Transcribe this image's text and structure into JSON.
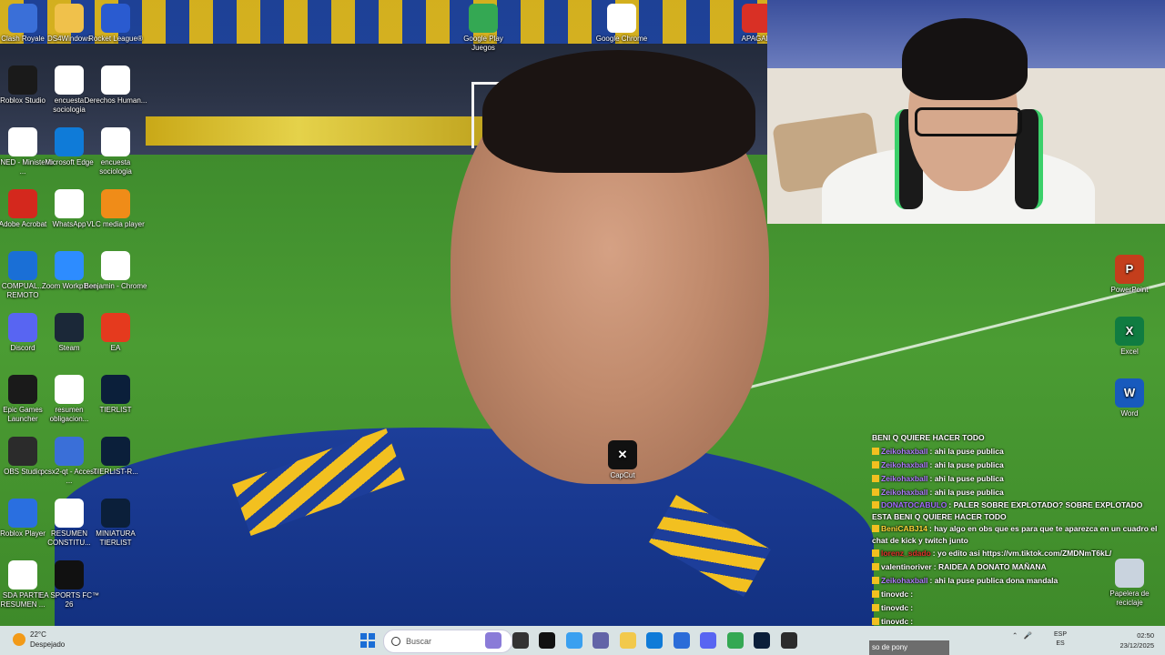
{
  "desktop": {
    "icons_left": [
      {
        "label": "Clash Royale",
        "icon": "clash-royale-icon",
        "color": "#3a6fd8"
      },
      {
        "label": "DS4Windows",
        "icon": "folder-icon",
        "color": "#f0c14b"
      },
      {
        "label": "Rocket League®",
        "icon": "rocket-league-icon",
        "color": "#2a5bd0"
      },
      {
        "label": "Roblox Studio",
        "icon": "roblox-studio-icon",
        "color": "#1a1a1a"
      },
      {
        "label": "encuesta sociologia",
        "icon": "chrome-icon",
        "color": "#ffffff"
      },
      {
        "label": "Derechos Human...",
        "icon": "word-icon",
        "color": "#ffffff"
      },
      {
        "label": "MINED - Ministerio ...",
        "icon": "chrome-icon",
        "color": "#ffffff"
      },
      {
        "label": "Microsoft Edge",
        "icon": "edge-icon",
        "color": "#0f7bd8"
      },
      {
        "label": "encuesta sociologia",
        "icon": "chrome-icon",
        "color": "#ffffff"
      },
      {
        "label": "Adobe Acrobat",
        "icon": "acrobat-icon",
        "color": "#d4281d"
      },
      {
        "label": "WhatsApp",
        "icon": "document-icon",
        "color": "#ffffff"
      },
      {
        "label": "VLC media player",
        "icon": "vlc-icon",
        "color": "#f08c18"
      },
      {
        "label": "COMPUAL... REMOTO",
        "icon": "teamviewer-icon",
        "color": "#1a6fd6"
      },
      {
        "label": "Zoom Workplace",
        "icon": "zoom-icon",
        "color": "#2d8cff"
      },
      {
        "label": "Benjamin - Chrome",
        "icon": "chrome-icon",
        "color": "#ffffff"
      },
      {
        "label": "Discord",
        "icon": "discord-icon",
        "color": "#5865f2"
      },
      {
        "label": "Steam",
        "icon": "steam-icon",
        "color": "#1b2838"
      },
      {
        "label": "EA",
        "icon": "ea-icon",
        "color": "#e53a1e"
      },
      {
        "label": "Epic Games Launcher",
        "icon": "epic-games-icon",
        "color": "#1a1a1a"
      },
      {
        "label": "resumen obligacion...",
        "icon": "word-icon",
        "color": "#ffffff"
      },
      {
        "label": "TIERLIST",
        "icon": "psb-icon",
        "color": "#0b1f3a"
      },
      {
        "label": "OBS Studio",
        "icon": "obs-icon",
        "color": "#2b2b2b"
      },
      {
        "label": "pcsx2-qt - Acceso ...",
        "icon": "pcsx2-icon",
        "color": "#3a6fd8"
      },
      {
        "label": "TIERLIST-R...",
        "icon": "psb-icon",
        "color": "#0b1f3a"
      },
      {
        "label": "Roblox Player",
        "icon": "roblox-icon",
        "color": "#2a6fe0"
      },
      {
        "label": "RESUMEN CONSTITU...",
        "icon": "word-icon",
        "color": "#ffffff"
      },
      {
        "label": "MINIATURA TIERLIST",
        "icon": "psb-icon",
        "color": "#0b1f3a"
      },
      {
        "label": "SDA PARTE RESUMEN ...",
        "icon": "word-icon",
        "color": "#ffffff"
      },
      {
        "label": "EA SPORTS FC™ 26",
        "icon": "ea-fc-icon",
        "color": "#111111"
      }
    ],
    "icons_top": [
      {
        "label": "Google Play Juegos",
        "icon": "google-play-icon",
        "color": "#34a853"
      },
      {
        "label": "Google Chrome",
        "icon": "chrome-icon",
        "color": "#ffffff"
      },
      {
        "label": "APAGAR",
        "icon": "power-icon",
        "color": "#d93025"
      }
    ],
    "icon_center": {
      "label": "CapCut",
      "icon": "capcut-icon",
      "color": "#111111"
    },
    "icons_right": [
      {
        "label": "PowerPoint",
        "icon": "powerpoint-icon",
        "color": "#c43e1c",
        "letter": "P"
      },
      {
        "label": "Excel",
        "icon": "excel-icon",
        "color": "#107c41",
        "letter": "X"
      },
      {
        "label": "Word",
        "icon": "word-icon",
        "color": "#185abd",
        "letter": "W"
      },
      {
        "label": "Papelera de reciclaje",
        "icon": "recycle-bin-icon",
        "color": "#c9d3de",
        "letter": ""
      }
    ]
  },
  "chat": {
    "lines": [
      {
        "user": "",
        "user_color": "#ffffff",
        "msg": "BENI Q QUIERE HACER TODO",
        "wrap": false
      },
      {
        "user": "Zeikohaxball",
        "user_color": "#b07cff",
        "msg": ": ahi la puse publica",
        "wrap": false
      },
      {
        "user": "Zeikohaxball",
        "user_color": "#b07cff",
        "msg": ": ahi la puse publica",
        "wrap": false
      },
      {
        "user": "Zeikohaxball",
        "user_color": "#b07cff",
        "msg": ": ahi la puse publica",
        "wrap": false
      },
      {
        "user": "Zeikohaxball",
        "user_color": "#b07cff",
        "msg": ": ahi la puse publica",
        "wrap": false
      },
      {
        "user": "DONATOCABULO",
        "user_color": "#a46cff",
        "msg": ": PALER SOBRE EXPLOTADO? SOBRE EXPLOTADO ESTA BENI Q QUIERE HACER TODO",
        "wrap": true
      },
      {
        "user": "BeniCABJ14",
        "user_color": "#ffd83a",
        "msg": ": hay algo en obs que es para que te aparezca en un cuadro el chat de kick y twitch junto",
        "wrap": true
      },
      {
        "user": "lorenz_sdado",
        "user_color": "#e0302a",
        "msg": ": yo edito asi https://vm.tiktok.com/ZMDNmT6kL/",
        "wrap": false
      },
      {
        "user": "valentinoriver",
        "user_color": "#ffffff",
        "msg": ": RAIDEA A DONATO MAÑANA",
        "wrap": false
      },
      {
        "user": "Zeikohaxball",
        "user_color": "#b07cff",
        "msg": ": ahi la puse publica dona mandala",
        "wrap": false
      },
      {
        "user": "tinovdc",
        "user_color": "#ffffff",
        "msg": ":",
        "wrap": false
      },
      {
        "user": "tinovdc",
        "user_color": "#ffffff",
        "msg": ":",
        "wrap": false
      },
      {
        "user": "tinovdc",
        "user_color": "#ffffff",
        "msg": ":",
        "wrap": false
      }
    ],
    "ticker": "so de pony"
  },
  "taskbar": {
    "weather_temp": "22°C",
    "weather_desc": "Despejado",
    "search_placeholder": "Buscar",
    "apps": [
      {
        "name": "taskbar-app-widgets",
        "color": "#8a7bd8"
      },
      {
        "name": "taskbar-app-task-view",
        "color": "#333333"
      },
      {
        "name": "taskbar-app-capcut",
        "color": "#111111"
      },
      {
        "name": "taskbar-app-copilot",
        "color": "#3aa0f0"
      },
      {
        "name": "taskbar-app-teams",
        "color": "#6264a7"
      },
      {
        "name": "taskbar-app-explorer",
        "color": "#f2c94c"
      },
      {
        "name": "taskbar-app-edge",
        "color": "#0f7bd8"
      },
      {
        "name": "taskbar-app-store",
        "color": "#2b6cd8"
      },
      {
        "name": "taskbar-app-discord",
        "color": "#5865f2"
      },
      {
        "name": "taskbar-app-chrome",
        "color": "#34a853"
      },
      {
        "name": "taskbar-app-photoshop",
        "color": "#0b1f3a"
      },
      {
        "name": "taskbar-app-obs",
        "color": "#2b2b2b"
      }
    ],
    "lang_top": "ESP",
    "lang_bottom": "ES",
    "time": "02:50",
    "date": "23/12/2025"
  }
}
